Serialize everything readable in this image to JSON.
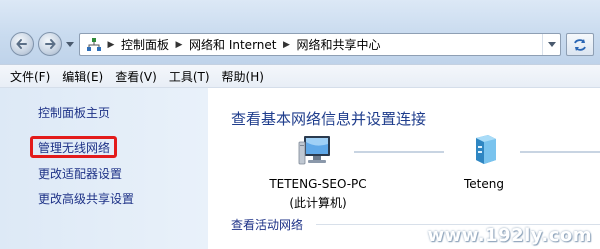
{
  "address_bar": {
    "crumbs": [
      "控制面板",
      "网络和 Internet",
      "网络和共享中心"
    ]
  },
  "menu": {
    "items": [
      "文件(F)",
      "编辑(E)",
      "查看(V)",
      "工具(T)",
      "帮助(H)"
    ]
  },
  "sidebar": {
    "items": [
      {
        "label": "控制面板主页"
      },
      {
        "label": "管理无线网络",
        "highlighted": true
      },
      {
        "label": "更改适配器设置"
      },
      {
        "label": "更改高级共享设置"
      }
    ],
    "highlight_color": "#e31b1b"
  },
  "main": {
    "title": "查看基本网络信息并设置连接",
    "computer_name": "TETENG-SEO-PC",
    "computer_sub": "(此计算机)",
    "network_name": "Teteng",
    "active_label": "查看活动网络",
    "title_color": "#1f3d8c",
    "link_color": "#1e3287"
  },
  "watermark": "www.192ly.com",
  "icons": [
    "back-arrow-icon",
    "forward-arrow-icon",
    "network-location-icon",
    "refresh-icon",
    "computer-icon",
    "network-icon"
  ]
}
